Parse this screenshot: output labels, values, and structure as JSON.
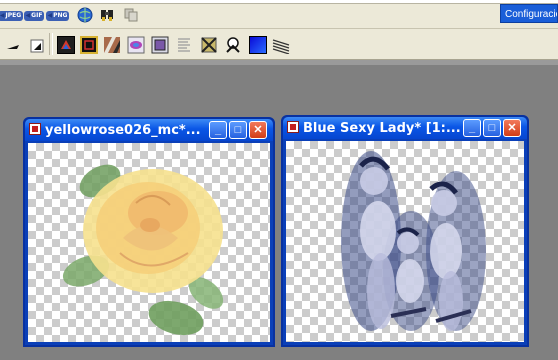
{
  "toolbar": {
    "formats": [
      "JPEG",
      "GIF",
      "PNG"
    ],
    "config_label": "Configuracion",
    "row1_icons": [
      "web-globe-icon",
      "binoculars-icon",
      "copy-icon"
    ],
    "row2_icons": [
      "arrow-cursor-icon",
      "selection-tool-icon",
      "effects-frame-icon",
      "edge-frame-icon",
      "texture-icon",
      "layer-icon",
      "image-icon",
      "striped-icon",
      "crop-icon",
      "warning-icon",
      "blue-square-icon",
      "stripes-icon"
    ]
  },
  "windows": [
    {
      "title": "yellowrose026_mc*...",
      "image": "yellow-rose-image",
      "buttons": [
        "minimize",
        "maximize",
        "close"
      ]
    },
    {
      "title": "Blue Sexy Lady* [1:...",
      "image": "blue-figure-art",
      "buttons": [
        "minimize",
        "maximize",
        "close"
      ]
    }
  ],
  "colors": {
    "titlebar": "#0a56e6",
    "workspace": "#808080",
    "close_button": "#d23c16",
    "config_button": "#1a5ed8"
  }
}
